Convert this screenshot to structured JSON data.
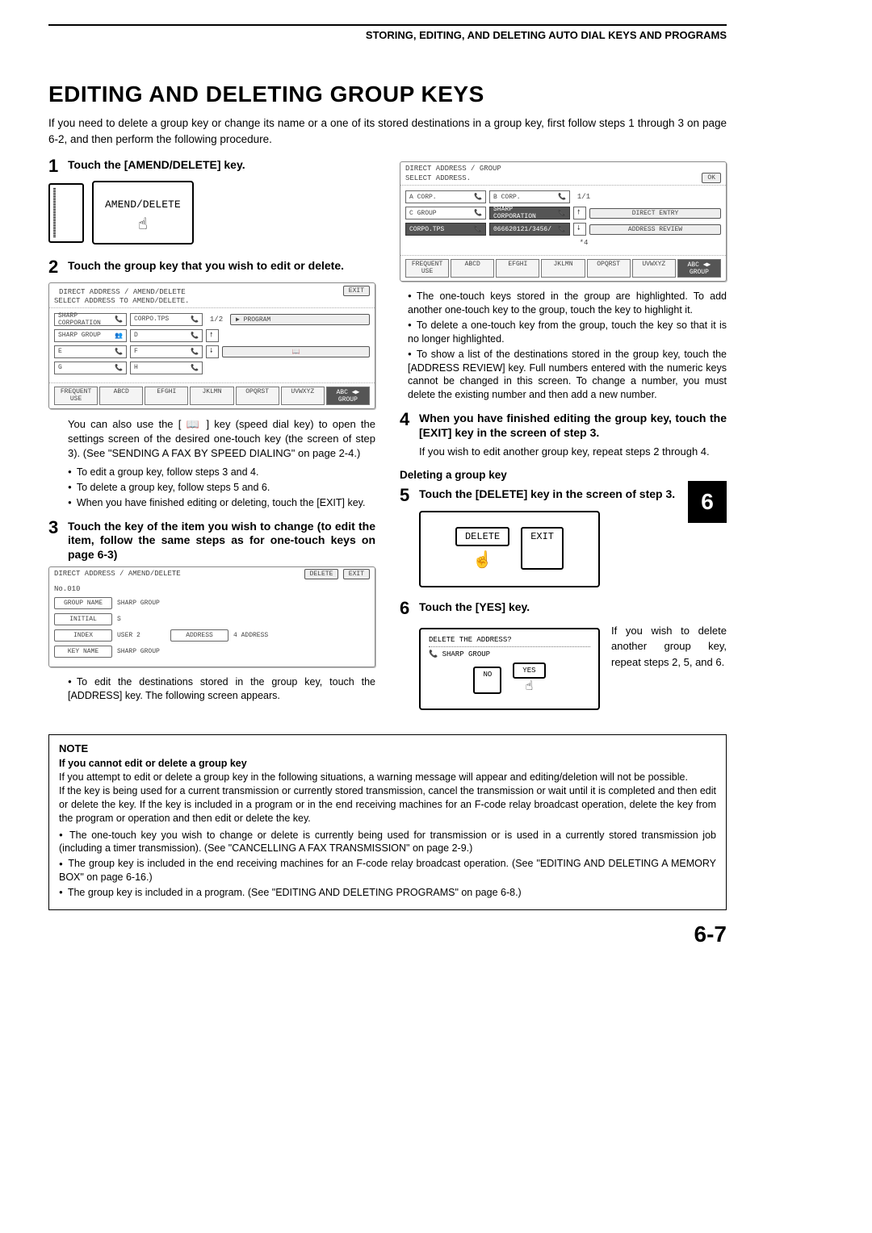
{
  "header": "STORING, EDITING, AND DELETING AUTO DIAL KEYS AND PROGRAMS",
  "title": "EDITING AND DELETING GROUP KEYS",
  "intro": "If you need to delete a group key or change its name or a one of its stored destinations in a group key, first follow steps 1 through 3 on page 6-2, and then perform the following procedure.",
  "step1": {
    "num": "1",
    "title": "Touch the [AMEND/DELETE] key.",
    "button_label": "AMEND/DELETE"
  },
  "step2": {
    "num": "2",
    "title": "Touch the group key that you wish to edit or delete.",
    "panel_title": "DIRECT ADDRESS / AMEND/DELETE",
    "panel_sub": "SELECT ADDRESS TO AMEND/DELETE.",
    "btn_exit": "EXIT",
    "cells": [
      "SHARP CORPORATION",
      "CORPO.TPS",
      "SHARP GROUP",
      "D",
      "E",
      "F",
      "G",
      "H"
    ],
    "page": "1/2",
    "btn_program": "PROGRAM",
    "tabs": [
      "FREQUENT USE",
      "ABCD",
      "EFGHI",
      "JKLMN",
      "OPQRST",
      "UVWXYZ"
    ],
    "tab_group_left": "ABC",
    "tab_group_right": "GROUP",
    "subtext": "You can also use the [ 📖 ] key (speed dial key) to open the settings screen of the desired one-touch key (the screen of step 3). (See \"SENDING A FAX BY SPEED DIALING\" on page 2-4.)",
    "bullets": [
      "To edit a group key, follow steps 3 and 4.",
      "To delete a group key, follow steps 5 and 6.",
      "When you have finished editing or deleting, touch the [EXIT] key."
    ]
  },
  "step3": {
    "num": "3",
    "title": "Touch the key of the item you wish to change (to edit the item, follow the same steps as for one-touch keys on page 6-3)",
    "panel_title": "DIRECT ADDRESS / AMEND/DELETE",
    "no": "No.010",
    "btn_delete": "DELETE",
    "btn_exit": "EXIT",
    "rows": {
      "group_name_l": "GROUP NAME",
      "group_name_v": "SHARP GROUP",
      "initial_l": "INITIAL",
      "initial_v": "S",
      "index_l": "INDEX",
      "index_v": "USER 2",
      "address_l": "ADDRESS",
      "address_v": "4 ADDRESS",
      "key_name_l": "KEY NAME",
      "key_name_v": "SHARP GROUP"
    },
    "bullets": [
      "To edit the destinations stored in the group key, touch the [ADDRESS] key. The following screen appears."
    ]
  },
  "right_panel": {
    "title": "DIRECT ADDRESS / GROUP",
    "sub": "SELECT ADDRESS.",
    "btn_ok": "OK",
    "cells": [
      "A CORP.",
      "B CORP.",
      "C GROUP",
      "SHARP CORPORATION",
      "CORPO.TPS",
      "066620121/3456/"
    ],
    "page": "1/1",
    "btn_direct": "DIRECT ENTRY",
    "btn_review": "ADDRESS REVIEW",
    "note_star": "*4",
    "tabs": [
      "FREQUENT USE",
      "ABCD",
      "EFGHI",
      "JKLMN",
      "OPQRST",
      "UVWXYZ"
    ],
    "tab_group_left": "ABC",
    "tab_group_right": "GROUP",
    "bullets": [
      "The one-touch keys stored in the group are highlighted. To add another one-touch key to the group, touch the key to highlight it.",
      "To delete a one-touch key from the group, touch the key so that it is no longer highlighted.",
      "To show a list of the destinations stored in the group key, touch the [ADDRESS REVIEW] key. Full numbers entered with the numeric keys cannot be changed in this screen. To change a number, you must delete the existing number and then add a new number."
    ]
  },
  "step4": {
    "num": "4",
    "title": "When you have finished editing the group key, touch the [EXIT] key in the screen of step 3.",
    "sub": "If you wish to edit another group key, repeat steps 2 through 4."
  },
  "del_heading": "Deleting a group key",
  "step5": {
    "num": "5",
    "title": "Touch the [DELETE] key in the screen of step 3.",
    "delete": "DELETE",
    "exit": "EXIT"
  },
  "step6": {
    "num": "6",
    "title": "Touch the [YES] key.",
    "question": "DELETE THE ADDRESS?",
    "group": "SHARP GROUP",
    "no": "NO",
    "yes": "YES",
    "side": "If you wish to delete another group key, repeat steps 2, 5, and 6."
  },
  "chapter": "6",
  "note": {
    "title": "NOTE",
    "sub": "If you cannot edit or delete a group key",
    "p1": "If you attempt to edit or delete a group key in the following situations, a warning message will appear and editing/deletion will not be possible.",
    "p2": "If the key is being used for a current transmission or currently stored transmission, cancel the transmission or wait until it is completed and then edit or delete the key. If the key is included in a program or in the end receiving machines for an F-code relay broadcast operation, delete the key from the program or operation and then edit or delete the key.",
    "bullets": [
      "The one-touch key you wish to change or delete is currently being used for transmission or is used in a currently stored transmission job (including a timer transmission). (See \"CANCELLING A FAX TRANSMISSION\" on page 2-9.)",
      "The group key is included in the end receiving machines for an F-code relay broadcast operation. (See \"EDITING AND DELETING A MEMORY BOX\" on page 6-16.)",
      "The group key is included in a program. (See \"EDITING AND DELETING PROGRAMS\" on page 6-8.)"
    ]
  },
  "page_number": "6-7"
}
